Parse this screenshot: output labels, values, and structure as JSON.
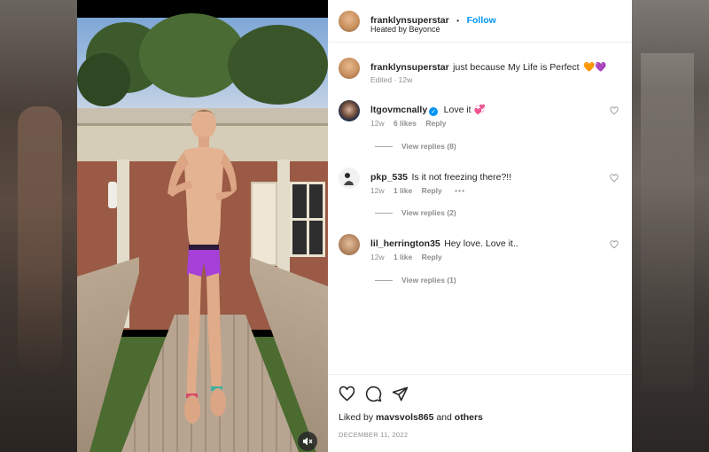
{
  "post": {
    "owner_username": "franklynsuperstar",
    "follow_separator": "•",
    "follow_label": "Follow",
    "audio": "Heated by Beyoncé",
    "caption_username": "franklynsuperstar",
    "caption_text": "just because My Life is Perfect",
    "caption_emojis": "🧡💜",
    "caption_meta": "Edited · 12w"
  },
  "comments": [
    {
      "username": "ltgovmcnally",
      "verified": true,
      "text": "Love it 💞",
      "age": "12w",
      "likes": "6 likes",
      "reply_label": "Reply",
      "view_replies": "View replies (8)"
    },
    {
      "username": "pkp_535",
      "verified": false,
      "text": "Is it not freezing there?!!",
      "age": "12w",
      "likes": "1 like",
      "reply_label": "Reply",
      "more": "•••",
      "view_replies": "View replies (2)"
    },
    {
      "username": "lil_herrington35",
      "verified": false,
      "text": "Hey love. Love it..",
      "age": "12w",
      "likes": "1 like",
      "reply_label": "Reply",
      "view_replies": "View replies (1)"
    }
  ],
  "actions": {
    "liked_by_prefix": "Liked by",
    "liked_by_user": "mavsvols865",
    "liked_by_and": "and",
    "liked_by_others": "others",
    "date": "DECEMBER 11, 2022",
    "icons": [
      "heart-icon",
      "comment-icon",
      "share-icon"
    ]
  },
  "colors": {
    "accent": "#0095f6",
    "text": "#262626",
    "muted": "#8e8e8e"
  }
}
